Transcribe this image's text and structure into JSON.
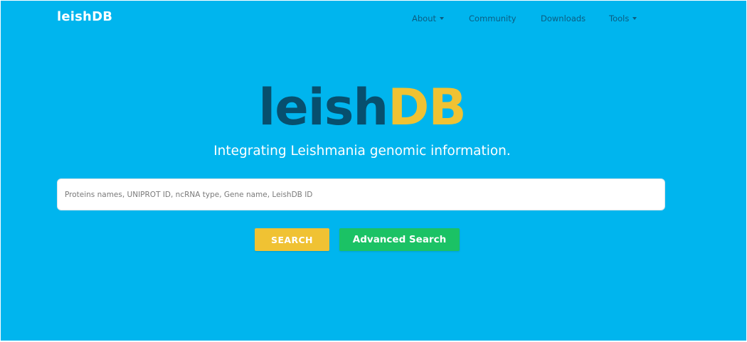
{
  "navbar": {
    "brand": "leishDB",
    "items": [
      {
        "label": "About",
        "dropdown": true
      },
      {
        "label": "Community",
        "dropdown": false
      },
      {
        "label": "Downloads",
        "dropdown": false
      },
      {
        "label": "Tools",
        "dropdown": true
      }
    ]
  },
  "hero": {
    "logo_part_a": "leish",
    "logo_part_b": "DB",
    "tagline": "Integrating Leishmania genomic information."
  },
  "search": {
    "value": "",
    "placeholder": "Proteins names, UNIPROT ID, ncRNA type, Gene name, LeishDB ID",
    "search_button": "SEARCH",
    "advanced_button": "Advanced Search"
  },
  "colors": {
    "background": "#00b5ee",
    "logo_dark": "#074f6e",
    "logo_yellow": "#f0c233",
    "search_button": "#f0c233",
    "advanced_button": "#1bc265",
    "nav_text": "#0c5c80"
  }
}
